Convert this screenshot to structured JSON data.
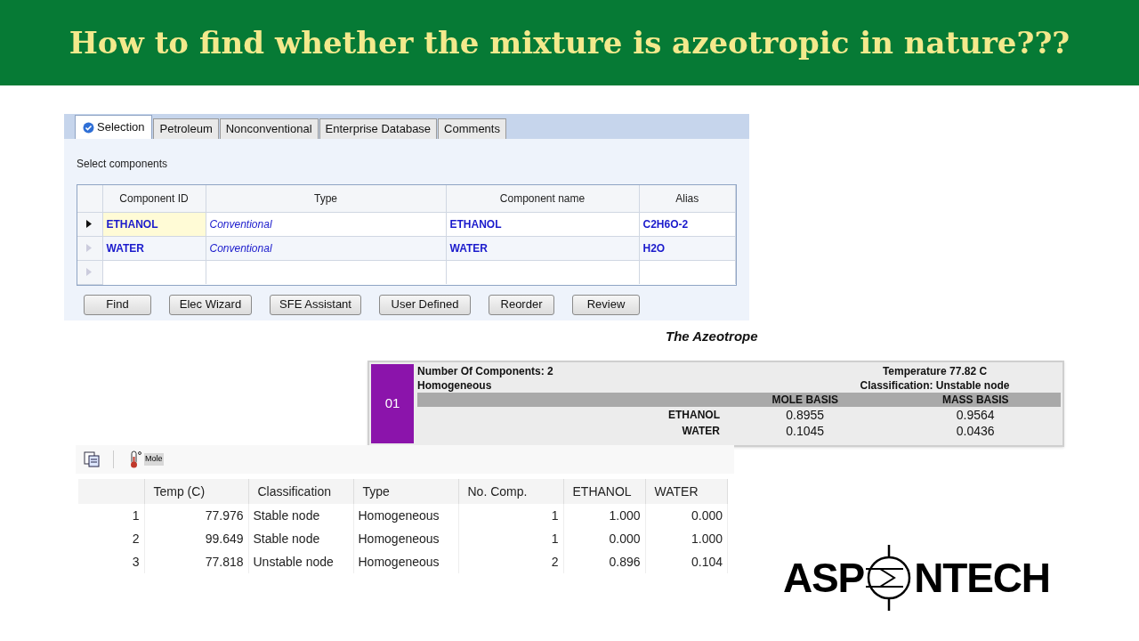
{
  "title": "How to find whether the mixture is azeotropic in nature???",
  "tabs": [
    {
      "label": "Selection",
      "selected": true,
      "verified": true
    },
    {
      "label": "Petroleum",
      "selected": false,
      "verified": false
    },
    {
      "label": "Nonconventional",
      "selected": false,
      "verified": false
    },
    {
      "label": "Enterprise Database",
      "selected": false,
      "verified": false
    },
    {
      "label": "Comments",
      "selected": false,
      "verified": false
    }
  ],
  "section_label": "Select components",
  "components": {
    "columns": [
      "Component ID",
      "Type",
      "Component name",
      "Alias"
    ],
    "rows": [
      {
        "selected": true,
        "cells": [
          "ETHANOL",
          "Conventional",
          "ETHANOL",
          "C2H6O-2"
        ]
      },
      {
        "selected": false,
        "cells": [
          "WATER",
          "Conventional",
          "WATER",
          "H2O"
        ]
      }
    ]
  },
  "buttons": [
    "Find",
    "Elec Wizard",
    "SFE Assistant",
    "User Defined",
    "Reorder",
    "Review"
  ],
  "azeotrope": {
    "heading": "The Azeotrope",
    "number": "01",
    "info_left": [
      "Number Of Components: 2",
      "Homogeneous"
    ],
    "info_right": [
      "Temperature 77.82 C",
      "Classification: Unstable node"
    ],
    "columns": [
      "MOLE BASIS",
      "MASS BASIS"
    ],
    "rows": [
      {
        "name": "ETHANOL",
        "values": [
          "0.8955",
          "0.9564"
        ]
      },
      {
        "name": "WATER",
        "values": [
          "0.1045",
          "0.0436"
        ]
      }
    ]
  },
  "toolbar": {
    "unit": "Mole"
  },
  "results": {
    "columns": [
      "",
      "Temp (C)",
      "Classification",
      "Type",
      "No. Comp.",
      "ETHANOL",
      "WATER"
    ],
    "rows": [
      [
        "1",
        "77.976",
        "Stable node",
        "Homogeneous",
        "1",
        "1.000",
        "0.000"
      ],
      [
        "2",
        "99.649",
        "Stable node",
        "Homogeneous",
        "1",
        "0.000",
        "1.000"
      ],
      [
        "3",
        "77.818",
        "Unstable node",
        "Homogeneous",
        "2",
        "0.896",
        "0.104"
      ]
    ]
  },
  "logo": {
    "left": "ASP",
    "right": "NTECH"
  }
}
